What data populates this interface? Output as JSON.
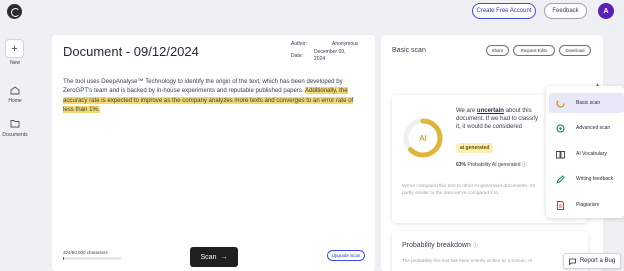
{
  "header": {
    "create_account": "Create Free Account",
    "feedback": "Feedback",
    "avatar_initial": "A"
  },
  "rail": {
    "new_label": "New",
    "home_label": "Home",
    "documents_label": "Documents"
  },
  "document": {
    "title": "Document - 09/12/2024",
    "author_label": "Author:",
    "author_value": "Anonymous",
    "date_label": "Date:",
    "date_value_line1": "December 09,",
    "date_value_line2": "2024",
    "text_plain": "The tool uses DeepAnalyse™ Technology to identify the origin of the text, which has been developed by ZeroGPT's team and is backed by in-house experiments and reputable published papers. ",
    "text_highlight": "Additionally, the accuracy rate is expected to improve as the company analyzes more texts and converges to an error rate of less than 1%.",
    "char_count": "324/50,000 characters",
    "char_progress": 0.00648,
    "scan_label": "Scan",
    "scan_arrow": "→",
    "upgrade_label": "Upgrade Scan"
  },
  "scan": {
    "title": "Basic scan",
    "share": "Share",
    "request_edits": "Request Edits",
    "download": "Download",
    "ring_label": "AI",
    "ai_probability": 0.63,
    "unsure_prefix": "We are ",
    "unsure_word": "uncertain",
    "unsure_suffix": " about this document. If we had to classify it, it would be considered",
    "badge": "ai generated",
    "prob_value": "63%",
    "prob_text": " Probability AI generated",
    "compare_text": "We've compared this text to other AI-generated documents, it's partly similar to the data we've compared it to.",
    "breakdown_title": "Probability breakdown",
    "breakdown_text": "The probability this text has been entirely written by a human, AI"
  },
  "menu": [
    {
      "label": "Basic scan",
      "icon": "basic-scan-icon",
      "active": true
    },
    {
      "label": "Advanced scan",
      "icon": "advanced-scan-icon",
      "active": false
    },
    {
      "label": "AI Vocabulary",
      "icon": "book-icon",
      "active": false
    },
    {
      "label": "Writing feedback",
      "icon": "pencil-icon",
      "active": false
    },
    {
      "label": "Plagiarism",
      "icon": "document-icon",
      "active": false
    }
  ],
  "report_bug": "Report a Bug",
  "colors": {
    "accent": "#3b4fd8",
    "ai_ring": "#e0b63a",
    "highlight": "#f4d86b"
  }
}
